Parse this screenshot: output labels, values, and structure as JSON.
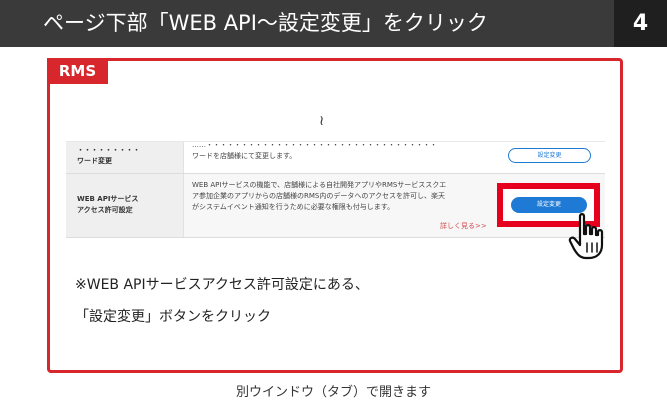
{
  "header": {
    "title": "ページ下部「WEB API〜設定変更」をクリック",
    "step": "4"
  },
  "rms_label": "RMS",
  "screenshot": {
    "tilde": "≀",
    "rows": [
      {
        "label_line1": "・・・・・・・・・",
        "label_line2": "ワード変更",
        "desc_line1": "……・・・・・・・・・・・・・・・・・・・・・・・・・・・・・・・・・",
        "desc_line2": "ワードを店舗様にて変更します。",
        "button": "設定変更"
      },
      {
        "label_line1": "WEB APIサービス",
        "label_line2": "アクセス許可設定",
        "desc_line1": "WEB APIサービスの機能で、店舗様による自社開発アプリやRMSサービススクエ",
        "desc_line2": "ア参加企業のアプリからの店舗様のRMS内のデータへのアクセスを許可し、楽天",
        "desc_line3": "がシステムイベント通知を行うために必要な権限も付与します。",
        "more_link": "詳しく見る>>",
        "button": "設定変更"
      }
    ]
  },
  "notes": {
    "line1": "※WEB APIサービスアクセス許可設定にある、",
    "line2": "「設定変更」ボタンをクリック"
  },
  "footer": "別ウインドウ（タブ）で開きます",
  "colors": {
    "header_bg": "#3a3a3a",
    "step_bg": "#1f1f1f",
    "accent_red": "#d7262c",
    "highlight_red": "#e6001e",
    "button_blue": "#1f7ad6"
  }
}
